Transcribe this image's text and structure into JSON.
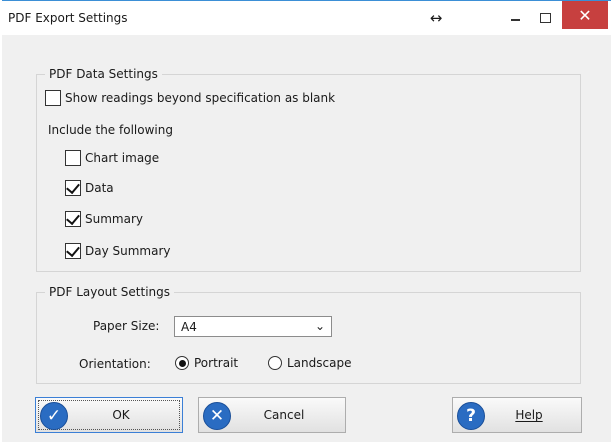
{
  "window": {
    "title": "PDF Export Settings"
  },
  "titlebar": {
    "resize_glyph": "↔",
    "close_glyph": "✕"
  },
  "data_settings": {
    "title": "PDF Data Settings",
    "blank_option": {
      "label": "Show readings beyond specification as blank",
      "checked": false
    },
    "include_label": "Include the following",
    "items": [
      {
        "label": "Chart image",
        "checked": false
      },
      {
        "label": "Data",
        "checked": true
      },
      {
        "label": "Summary",
        "checked": true
      },
      {
        "label": "Day Summary",
        "checked": true
      }
    ]
  },
  "layout_settings": {
    "title": "PDF Layout Settings",
    "paper_size_label": "Paper Size:",
    "paper_size_value": "A4",
    "orientation_label": "Orientation:",
    "orientation_options": [
      {
        "label": "Portrait",
        "selected": true
      },
      {
        "label": "Landscape",
        "selected": false
      }
    ]
  },
  "buttons": {
    "ok": "OK",
    "cancel": "Cancel",
    "help": "Help"
  },
  "icons": {
    "ok": "check-icon",
    "cancel": "x-circle-icon",
    "help": "question-icon"
  },
  "colors": {
    "accent": "#2a6cc2",
    "close": "#c7403f"
  }
}
